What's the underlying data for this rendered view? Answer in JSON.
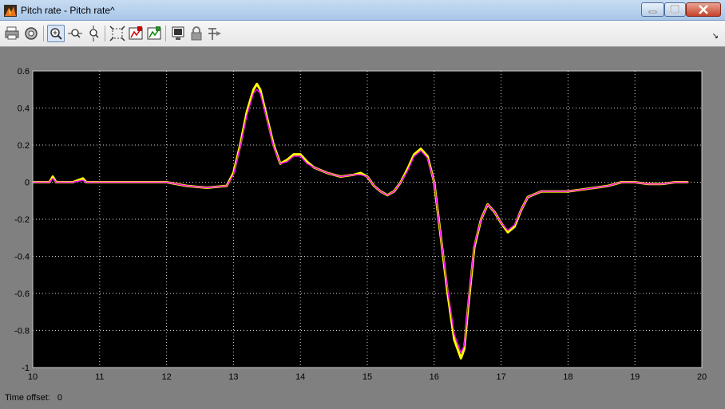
{
  "window": {
    "title": "Pitch rate - Pitch rate^"
  },
  "toolbar": {
    "icons": [
      "print-icon",
      "parameters-icon",
      "zoom-icon",
      "zoom-x-icon",
      "zoom-y-icon",
      "autoscale-icon",
      "save-axes-icon",
      "restore-axes-icon",
      "floating-scope-icon",
      "lock-icon",
      "signal-selection-icon",
      "dock-icon"
    ]
  },
  "status": {
    "label": "Time offset:",
    "value": "0"
  },
  "colors": {
    "plot_bg": "#000000",
    "frame_bg": "#808080",
    "signal_1": "#ffff00",
    "signal_2": "#ff00ff",
    "grid": "#ffffff"
  },
  "chart_data": {
    "type": "line",
    "title": "",
    "xlabel": "",
    "ylabel": "",
    "xlim": [
      10,
      20
    ],
    "ylim": [
      -1,
      0.6
    ],
    "xticks": [
      "10",
      "11",
      "12",
      "13",
      "14",
      "15",
      "16",
      "17",
      "18",
      "19",
      "20"
    ],
    "yticks": [
      "0.6",
      "0.4",
      "0.2",
      "0",
      "-0.2",
      "-0.4",
      "-0.6",
      "-0.8",
      "-1"
    ],
    "grid": true,
    "series": [
      {
        "color": "#ffff00",
        "x": [
          10.0,
          10.25,
          10.3,
          10.35,
          10.5,
          10.6,
          10.75,
          10.8,
          11.0,
          11.5,
          12.0,
          12.3,
          12.6,
          12.9,
          13.0,
          13.1,
          13.2,
          13.3,
          13.35,
          13.4,
          13.5,
          13.6,
          13.7,
          13.8,
          13.9,
          14.0,
          14.1,
          14.2,
          14.4,
          14.6,
          14.8,
          14.9,
          15.0,
          15.1,
          15.2,
          15.3,
          15.4,
          15.5,
          15.6,
          15.7,
          15.8,
          15.9,
          16.0,
          16.05,
          16.1,
          16.2,
          16.3,
          16.4,
          16.45,
          16.5,
          16.6,
          16.7,
          16.8,
          16.9,
          17.0,
          17.1,
          17.2,
          17.3,
          17.4,
          17.6,
          17.8,
          18.0,
          18.2,
          18.4,
          18.6,
          18.8,
          19.0,
          19.2,
          19.4,
          19.6,
          19.8
        ],
        "y": [
          0.0,
          0.0,
          0.03,
          0.0,
          0.0,
          0.0,
          0.02,
          0.0,
          0.0,
          0.0,
          0.0,
          -0.02,
          -0.03,
          -0.02,
          0.05,
          0.2,
          0.38,
          0.5,
          0.53,
          0.5,
          0.35,
          0.2,
          0.1,
          0.12,
          0.15,
          0.15,
          0.11,
          0.08,
          0.05,
          0.03,
          0.04,
          0.05,
          0.03,
          -0.02,
          -0.05,
          -0.07,
          -0.05,
          0.0,
          0.07,
          0.15,
          0.18,
          0.14,
          0.0,
          -0.15,
          -0.3,
          -0.6,
          -0.85,
          -0.95,
          -0.9,
          -0.7,
          -0.35,
          -0.2,
          -0.12,
          -0.16,
          -0.22,
          -0.27,
          -0.24,
          -0.15,
          -0.08,
          -0.05,
          -0.05,
          -0.05,
          -0.04,
          -0.03,
          -0.02,
          0.0,
          0.0,
          -0.01,
          -0.01,
          0.0,
          0.0
        ]
      },
      {
        "color": "#ff00ff",
        "x": [
          10.0,
          10.25,
          10.3,
          10.35,
          10.5,
          10.6,
          10.75,
          10.8,
          11.0,
          11.5,
          12.0,
          12.3,
          12.6,
          12.9,
          13.0,
          13.1,
          13.2,
          13.3,
          13.35,
          13.4,
          13.5,
          13.6,
          13.7,
          13.8,
          13.9,
          14.0,
          14.1,
          14.2,
          14.4,
          14.6,
          14.8,
          14.9,
          15.0,
          15.1,
          15.2,
          15.3,
          15.4,
          15.5,
          15.6,
          15.7,
          15.8,
          15.9,
          16.0,
          16.05,
          16.1,
          16.2,
          16.3,
          16.4,
          16.45,
          16.5,
          16.6,
          16.7,
          16.8,
          16.9,
          17.0,
          17.1,
          17.2,
          17.3,
          17.4,
          17.6,
          17.8,
          18.0,
          18.2,
          18.4,
          18.6,
          18.8,
          19.0,
          19.2,
          19.4,
          19.6,
          19.8
        ],
        "y": [
          0.0,
          0.0,
          0.02,
          0.0,
          0.0,
          0.0,
          0.01,
          0.0,
          0.0,
          0.0,
          0.0,
          -0.02,
          -0.03,
          -0.02,
          0.04,
          0.19,
          0.36,
          0.48,
          0.5,
          0.48,
          0.34,
          0.19,
          0.1,
          0.11,
          0.14,
          0.14,
          0.1,
          0.08,
          0.05,
          0.03,
          0.04,
          0.04,
          0.03,
          -0.02,
          -0.05,
          -0.07,
          -0.05,
          0.0,
          0.06,
          0.14,
          0.17,
          0.13,
          0.0,
          -0.15,
          -0.3,
          -0.58,
          -0.82,
          -0.92,
          -0.88,
          -0.68,
          -0.34,
          -0.2,
          -0.12,
          -0.16,
          -0.22,
          -0.26,
          -0.23,
          -0.15,
          -0.08,
          -0.05,
          -0.05,
          -0.05,
          -0.04,
          -0.03,
          -0.02,
          0.0,
          0.0,
          -0.01,
          -0.01,
          0.0,
          0.0
        ]
      }
    ]
  }
}
